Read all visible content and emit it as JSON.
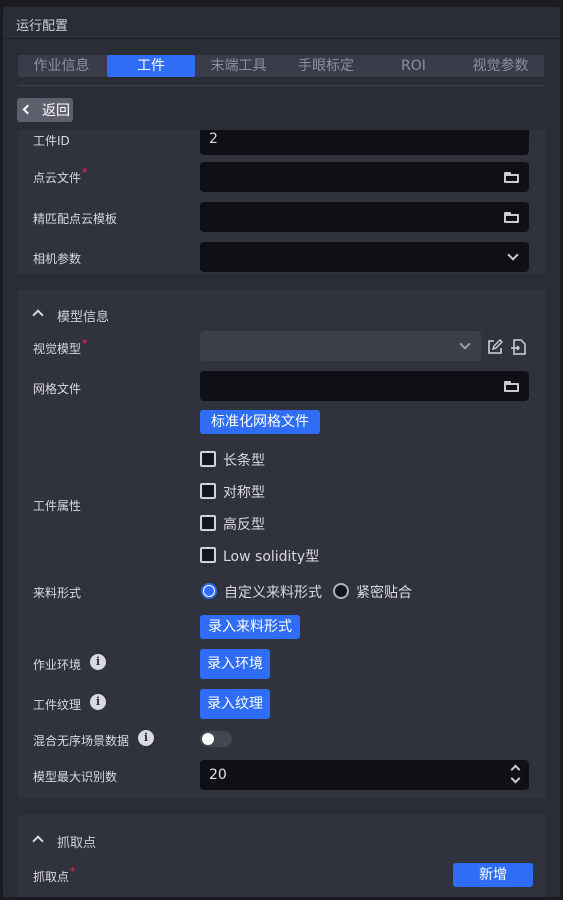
{
  "panel": {
    "title": "运行配置"
  },
  "tabs": [
    {
      "label": "作业信息",
      "active": false
    },
    {
      "label": "工件",
      "active": true
    },
    {
      "label": "末端工具",
      "active": false
    },
    {
      "label": "手眼标定",
      "active": false
    },
    {
      "label": "ROI",
      "active": false
    },
    {
      "label": "视觉参数",
      "active": false
    }
  ],
  "back_button": {
    "label": "返回"
  },
  "workpiece_basic": {
    "workpiece_id_label": "工件ID",
    "workpiece_id_value": "2",
    "point_cloud_file_label": "点云文件",
    "point_cloud_file_value": "",
    "fine_match_template_label": "精匹配点云模板",
    "fine_match_template_value": "",
    "camera_params_label": "相机参数",
    "camera_params_value": ""
  },
  "model_info": {
    "section_title": "模型信息",
    "vision_model_label": "视觉模型",
    "vision_model_value": "",
    "mesh_file_label": "网格文件",
    "mesh_file_value": "",
    "normalize_mesh_button": "标准化网格文件",
    "workpiece_props_label": "工件属性",
    "workpiece_props": [
      {
        "label": "长条型",
        "checked": false
      },
      {
        "label": "对称型",
        "checked": false
      },
      {
        "label": "高反型",
        "checked": false
      },
      {
        "label": "Low solidity型",
        "checked": false
      }
    ],
    "feed_mode_label": "来料形式",
    "feed_mode_options": [
      {
        "label": "自定义来料形式",
        "selected": true
      },
      {
        "label": "紧密贴合",
        "selected": false
      }
    ],
    "record_feed_mode_button": "录入来料形式",
    "work_env_label": "作业环境",
    "record_env_button": "录入环境",
    "texture_label": "工件纹理",
    "record_texture_button": "录入纹理",
    "mixed_unordered_label": "混合无序场景数据",
    "mixed_unordered_enabled": false,
    "max_recognition_label": "模型最大识别数",
    "max_recognition_value": "20"
  },
  "grasp_points": {
    "section_title": "抓取点",
    "grasp_points_label": "抓取点",
    "add_button": "新增"
  },
  "colors": {
    "accent": "#2f6df6",
    "required": "#e4383d",
    "panel_bg": "#2a2c36",
    "card_bg": "#30323d",
    "input_bg": "#0f1015"
  },
  "icons": {
    "back": "chevron-left-icon",
    "file_picker": "folder-open-icon",
    "dropdown": "chevron-down-icon",
    "collapse": "chevron-up-icon",
    "edit": "edit-icon",
    "export": "export-file-icon",
    "info": "info-icon"
  }
}
